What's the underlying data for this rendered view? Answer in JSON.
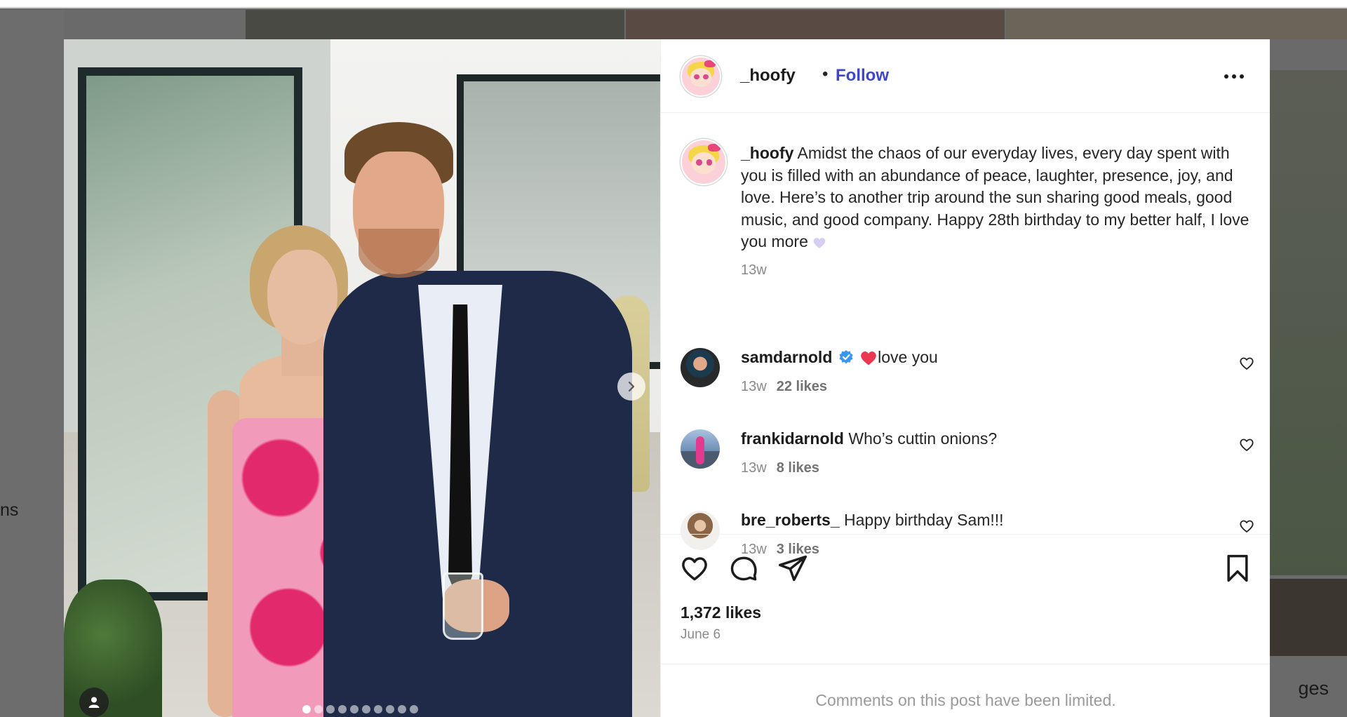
{
  "background": {
    "left_fragment": "ns",
    "right_fragment": "ges"
  },
  "photo": {
    "carousel_total": 10,
    "carousel_active_index": 0
  },
  "post": {
    "author": "_hoofy",
    "separator": "•",
    "follow_label": "Follow",
    "caption_text": " Amidst the chaos of our everyday lives, every day spent with you is filled with an abundance of peace, laughter, presence, joy, and love. Here’s to another trip around the sun sharing good meals, good music, and good company. Happy 28th birthday to my better half, I love you more ",
    "caption_emoji": "purple-heart-icon",
    "caption_time": "13w",
    "likes": "1,372 likes",
    "date": "June 6",
    "comments_limited": "Comments on this post have been limited."
  },
  "comments": [
    {
      "username": "samdarnold",
      "verified": true,
      "emoji": "red-heart-icon",
      "text": "love you",
      "time": "13w",
      "likes": "22 likes"
    },
    {
      "username": "frankidarnold",
      "verified": false,
      "text": " Who’s cuttin onions?",
      "time": "13w",
      "likes": "8 likes"
    },
    {
      "username": "bre_roberts_",
      "verified": false,
      "text": " Happy birthday Sam!!!",
      "time": "13w",
      "likes": "3 likes"
    }
  ],
  "colors": {
    "follow": "#3f47c9",
    "verified": "#3897f0",
    "backdrop": "#6a6a6a"
  }
}
